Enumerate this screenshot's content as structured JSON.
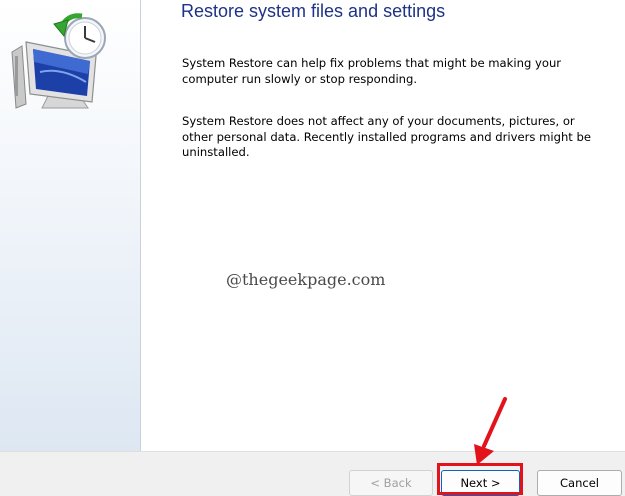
{
  "dialog": {
    "title": "Restore system files and settings",
    "paragraph_1": "System Restore can help fix problems that might be making your computer run slowly or stop responding.",
    "paragraph_2": "System Restore does not affect any of your documents, pictures, or other personal data. Recently installed programs and drivers might be uninstalled.",
    "icon": "system-restore-icon"
  },
  "watermark": "@thegeekpage.com",
  "buttons": {
    "back_label": "< Back",
    "next_label": "Next >",
    "cancel_label": "Cancel"
  },
  "annotation": {
    "highlight_color": "#e3131b",
    "arrow_icon": "red-arrow-icon"
  },
  "colors": {
    "title": "#1e3287",
    "side_panel": "#dde7f2",
    "footer": "#f0f0f0"
  }
}
